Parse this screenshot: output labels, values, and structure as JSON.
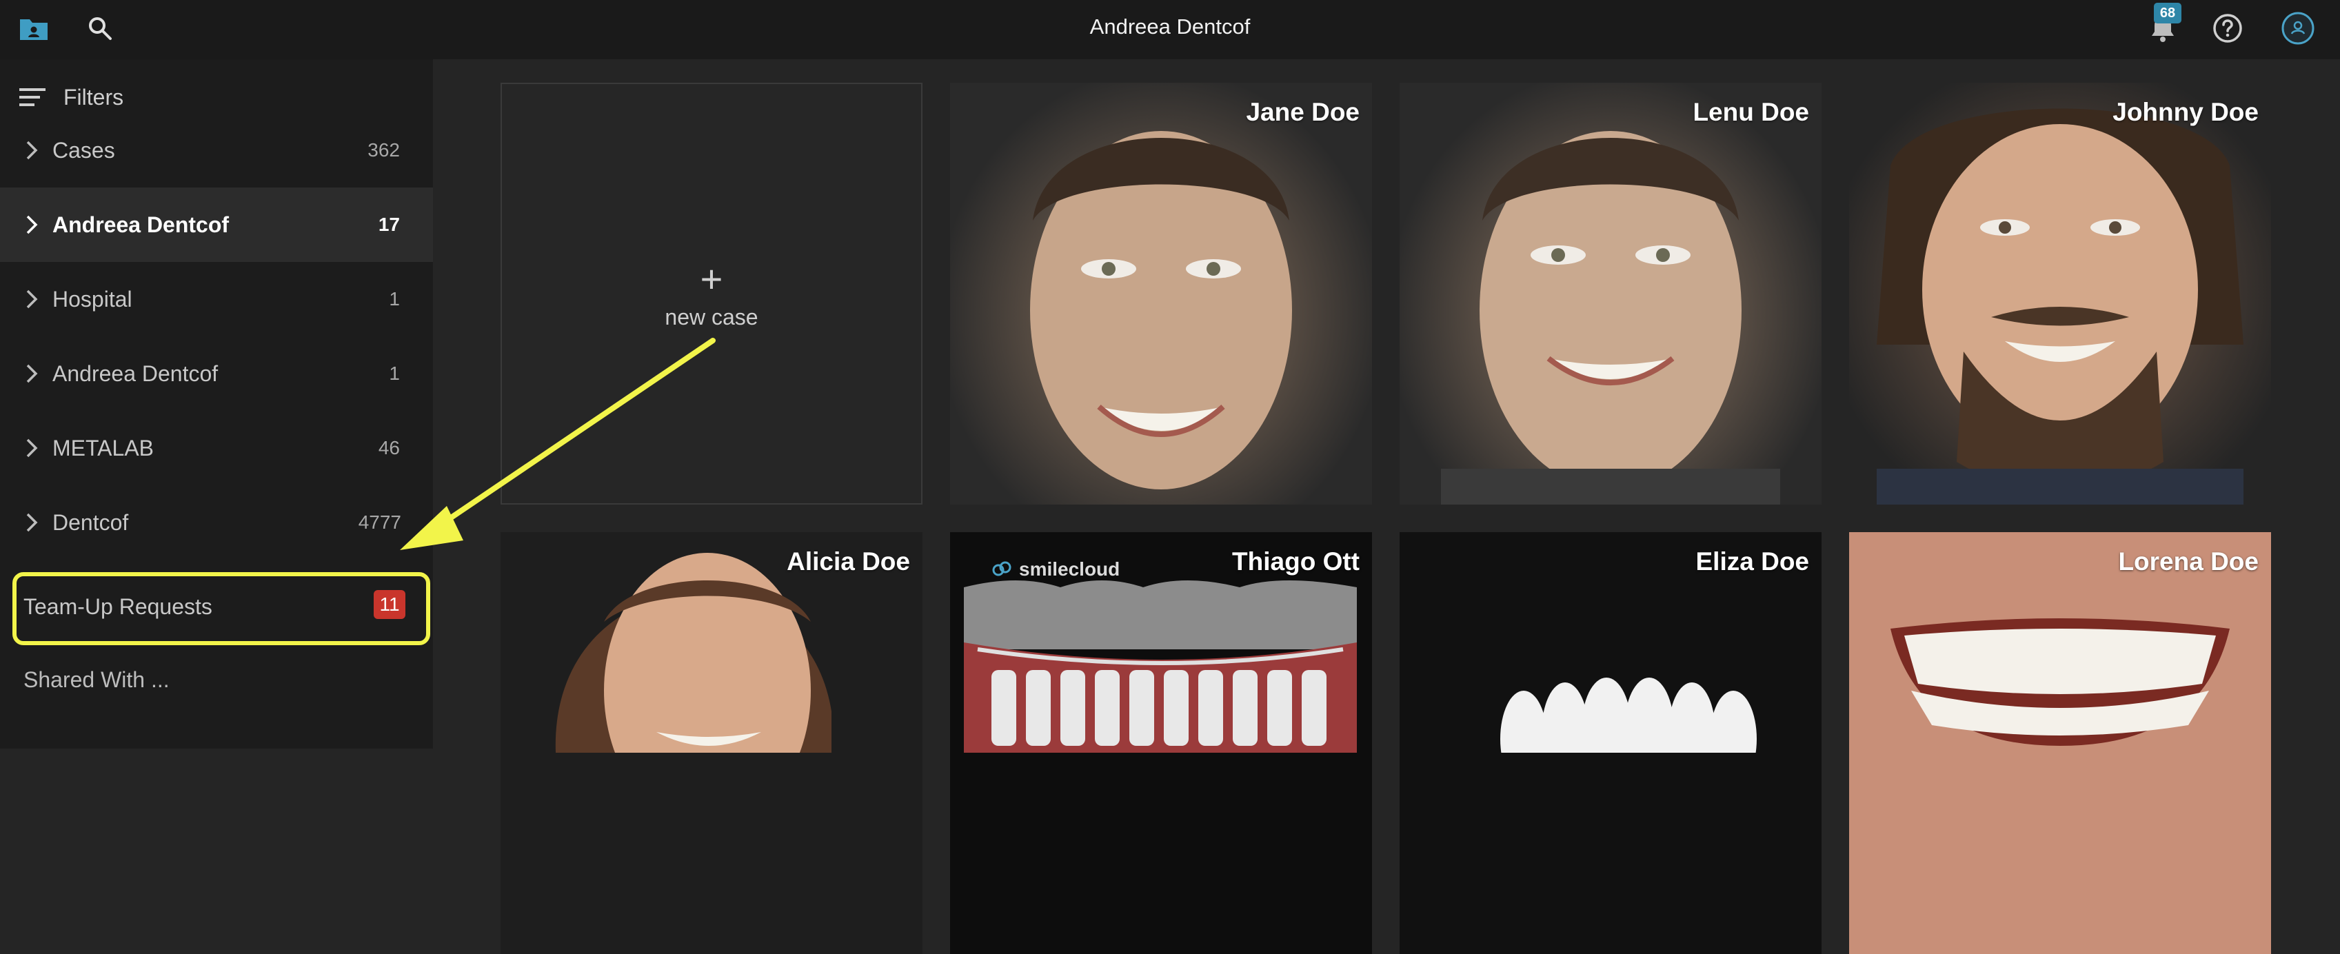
{
  "header": {
    "title": "Andreea Dentcof",
    "notification_count": "68"
  },
  "sidebar": {
    "filters_label": "Filters",
    "items": [
      {
        "label": "Cases",
        "count": "362"
      },
      {
        "label": "Andreea Dentcof",
        "count": "17",
        "active": true
      },
      {
        "label": "Hospital",
        "count": "1"
      },
      {
        "label": "Andreea Dentcof",
        "count": "1"
      },
      {
        "label": "METALAB",
        "count": "46"
      },
      {
        "label": "Dentcof",
        "count": "4777"
      }
    ],
    "team_up": {
      "label": "Team-Up Requests",
      "count": "11"
    },
    "shared_label": "Shared With ..."
  },
  "grid": {
    "new_case_label": "new case",
    "cards": [
      {
        "name": "Jane Doe"
      },
      {
        "name": "Lenu Doe"
      },
      {
        "name": "Johnny Doe"
      },
      {
        "name": "Alicia Doe"
      },
      {
        "name": "Thiago Ott",
        "logo_text": "smilecloud"
      },
      {
        "name": "Eliza Doe"
      },
      {
        "name": "Lorena Doe"
      }
    ]
  },
  "colors": {
    "accent": "#2e86a8",
    "highlight": "#f2f44a",
    "badge_red": "#c9352c"
  }
}
